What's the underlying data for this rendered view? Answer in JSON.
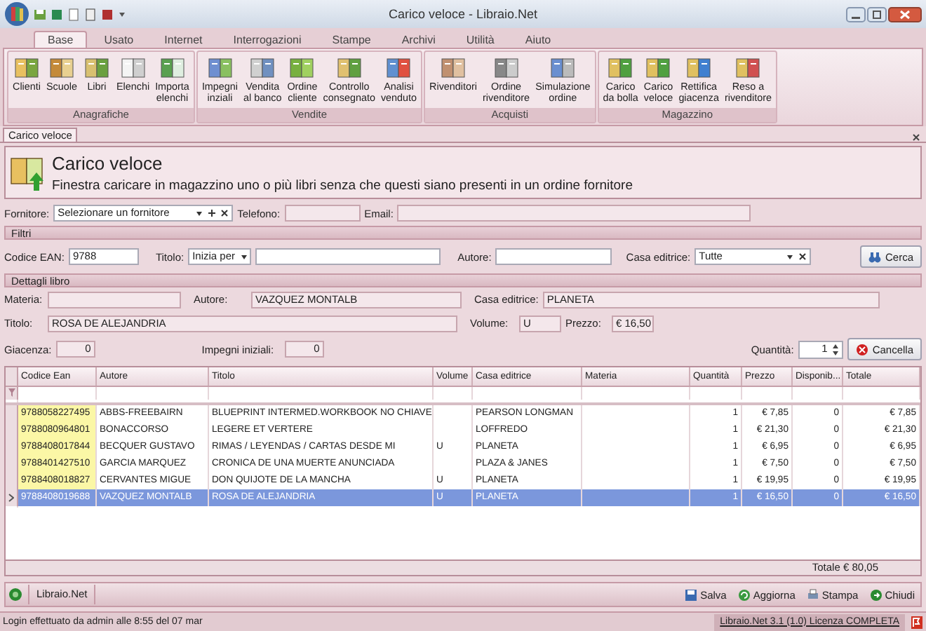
{
  "window": {
    "title": "Carico veloce - Libraio.Net"
  },
  "ribbon": {
    "tabs": [
      {
        "label": "Base",
        "selected": true
      },
      {
        "label": "Usato",
        "selected": false
      },
      {
        "label": "Internet",
        "selected": false
      },
      {
        "label": "Interrogazioni",
        "selected": false
      },
      {
        "label": "Stampe",
        "selected": false
      },
      {
        "label": "Archivi",
        "selected": false
      },
      {
        "label": "Utilità",
        "selected": false
      },
      {
        "label": "Aiuto",
        "selected": false
      }
    ],
    "groups": [
      {
        "label": "Anagrafiche",
        "buttons": [
          "Clienti",
          "Scuole",
          "Libri",
          "Elenchi",
          "Importa\nelenchi"
        ]
      },
      {
        "label": "Vendite",
        "buttons": [
          "Impegni\ninziali",
          "Vendita\nal banco",
          "Ordine\ncliente",
          "Controllo\nconsegnato",
          "Analisi\nvenduto"
        ]
      },
      {
        "label": "Acquisti",
        "buttons": [
          "Rivenditori",
          "Ordine\nrivenditore",
          "Simulazione\nordine"
        ]
      },
      {
        "label": "Magazzino",
        "buttons": [
          "Carico\nda bolla",
          "Carico\nveloce",
          "Rettifica\ngiacenza",
          "Reso a\nrivenditore"
        ]
      }
    ]
  },
  "document_tab": {
    "label": "Carico veloce"
  },
  "header": {
    "title": "Carico veloce",
    "description": "Finestra caricare in magazzino uno o più libri senza che questi siano presenti in un ordine fornitore"
  },
  "supplier": {
    "label": "Fornitore:",
    "value": "Selezionare un fornitore",
    "phone_label": "Telefono:",
    "email_label": "Email:"
  },
  "filters": {
    "title": "Filtri",
    "ean_label": "Codice EAN:",
    "ean": "9788",
    "title_label": "Titolo:",
    "title_mode": "Inizia per",
    "author_label": "Autore:",
    "publisher_label": "Casa editrice:",
    "publisher": "Tutte",
    "search_button": "Cerca"
  },
  "details": {
    "title": "Dettagli libro",
    "materia": {
      "label": "Materia:"
    },
    "autore": {
      "label": "Autore:",
      "value": "VAZQUEZ MONTALB"
    },
    "casa_editrice": {
      "label": "Casa editrice:",
      "value": "PLANETA"
    },
    "titolo": {
      "label": "Titolo:",
      "value": "ROSA DE ALEJANDRIA"
    },
    "volume": {
      "label": "Volume:",
      "value": "U"
    },
    "prezzo": {
      "label": "Prezzo:",
      "value": "€ 16,50"
    },
    "giacenza": {
      "label": "Giacenza:",
      "value": "0"
    },
    "impegni": {
      "label": "Impegni iniziali:",
      "value": "0"
    },
    "quantita": {
      "label": "Quantità:",
      "value": "1"
    },
    "cancel_button": "Cancella"
  },
  "grid": {
    "columns": [
      "Codice Ean",
      "Autore",
      "Titolo",
      "Volume",
      "Casa editrice",
      "Materia",
      "Quantità",
      "Prezzo",
      "Disponib...",
      "Totale"
    ],
    "rows": [
      {
        "ean": "9788058227495",
        "autore": "ABBS-FREEBAIRN",
        "titolo": "BLUEPRINT INTERMED.WORKBOOK NO CHIAVE",
        "casa_editrice": "PEARSON LONGMAN",
        "quantita": "1",
        "prezzo": "€ 7,85",
        "disponibile": "0",
        "totale": "€ 7,85",
        "highlighted": true,
        "selected": false
      },
      {
        "ean": "9788080964801",
        "autore": "BONACCORSO",
        "titolo": "LEGERE ET VERTERE",
        "casa_editrice": "LOFFREDO",
        "quantita": "1",
        "prezzo": "€ 21,30",
        "disponibile": "0",
        "totale": "€ 21,30",
        "highlighted": true,
        "selected": false
      },
      {
        "ean": "9788408017844",
        "autore": "BECQUER GUSTAVO",
        "titolo": "RIMAS / LEYENDAS / CARTAS DESDE MI",
        "volume": "U",
        "casa_editrice": "PLANETA",
        "quantita": "1",
        "prezzo": "€ 6,95",
        "disponibile": "0",
        "totale": "€ 6,95",
        "highlighted": true,
        "selected": false
      },
      {
        "ean": "9788401427510",
        "autore": "GARCIA MARQUEZ",
        "titolo": "CRONICA DE UNA MUERTE ANUNCIADA",
        "casa_editrice": "PLAZA & JANES",
        "quantita": "1",
        "prezzo": "€ 7,50",
        "disponibile": "0",
        "totale": "€ 7,50",
        "highlighted": true,
        "selected": false
      },
      {
        "ean": "9788408018827",
        "autore": "CERVANTES MIGUE",
        "titolo": "DON QUIJOTE DE LA MANCHA",
        "volume": "U",
        "casa_editrice": "PLANETA",
        "quantita": "1",
        "prezzo": "€ 19,95",
        "disponibile": "0",
        "totale": "€ 19,95",
        "highlighted": true,
        "selected": false
      },
      {
        "ean": "9788408019688",
        "autore": "VAZQUEZ MONTALB",
        "titolo": "ROSA DE ALEJANDRIA",
        "volume": "U",
        "casa_editrice": "PLANETA",
        "quantita": "1",
        "prezzo": "€ 16,50",
        "disponibile": "0",
        "totale": "€ 16,50",
        "highlighted": false,
        "selected": true
      }
    ],
    "total": "Totale € 80,05"
  },
  "action_bar": {
    "label": "Libraio.Net",
    "buttons": [
      "Salva",
      "Aggiorna",
      "Stampa",
      "Chiudi"
    ]
  },
  "status_bar": {
    "login": "Login effettuato da admin alle 8:55 del 07 mar",
    "license": "Libraio.Net 3.1 (1.0) Licenza COMPLETA"
  }
}
